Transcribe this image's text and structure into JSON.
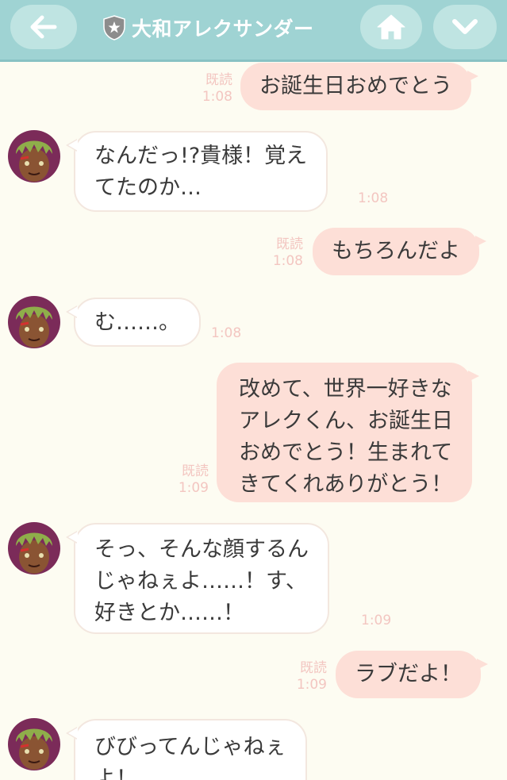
{
  "header": {
    "title": "大和アレクサンダー",
    "back_icon": "back-arrow-icon",
    "home_icon": "home-icon",
    "down_icon": "chevron-down-icon",
    "badge_icon": "shield-star-icon",
    "bg_color": "#9fd3d3",
    "button_color": "#bfe4e2"
  },
  "colors": {
    "background": "#fdfcf2",
    "outgoing_bubble": "#fddfd7",
    "incoming_bubble": "#ffffff",
    "meta_text": "#f3c6c1"
  },
  "messages": [
    {
      "from": "me",
      "lines": [
        "お誕生日おめでとう"
      ],
      "read": "既読",
      "time": "1:08"
    },
    {
      "from": "alex",
      "lines": [
        "なんだっ!?貴様！覚え",
        "てたのか…"
      ],
      "time": "1:08"
    },
    {
      "from": "me",
      "lines": [
        "もちろんだよ"
      ],
      "read": "既読",
      "time": "1:08"
    },
    {
      "from": "alex",
      "lines": [
        "む……。"
      ],
      "time": "1:08"
    },
    {
      "from": "me",
      "lines": [
        "改めて、世界一好きな",
        "アレクくん、お誕生日",
        "おめでとう！生まれて",
        "きてくれありがとう！"
      ],
      "read": "既読",
      "time": "1:09"
    },
    {
      "from": "alex",
      "lines": [
        "そっ、そんな顔するん",
        "じゃねぇよ……！す、",
        "好きとか……！"
      ],
      "time": "1:09"
    },
    {
      "from": "me",
      "lines": [
        "ラブだよ！"
      ],
      "read": "既読",
      "time": "1:09"
    },
    {
      "from": "alex",
      "lines": [
        "びびってんじゃねぇ",
        "よ！"
      ]
    }
  ]
}
